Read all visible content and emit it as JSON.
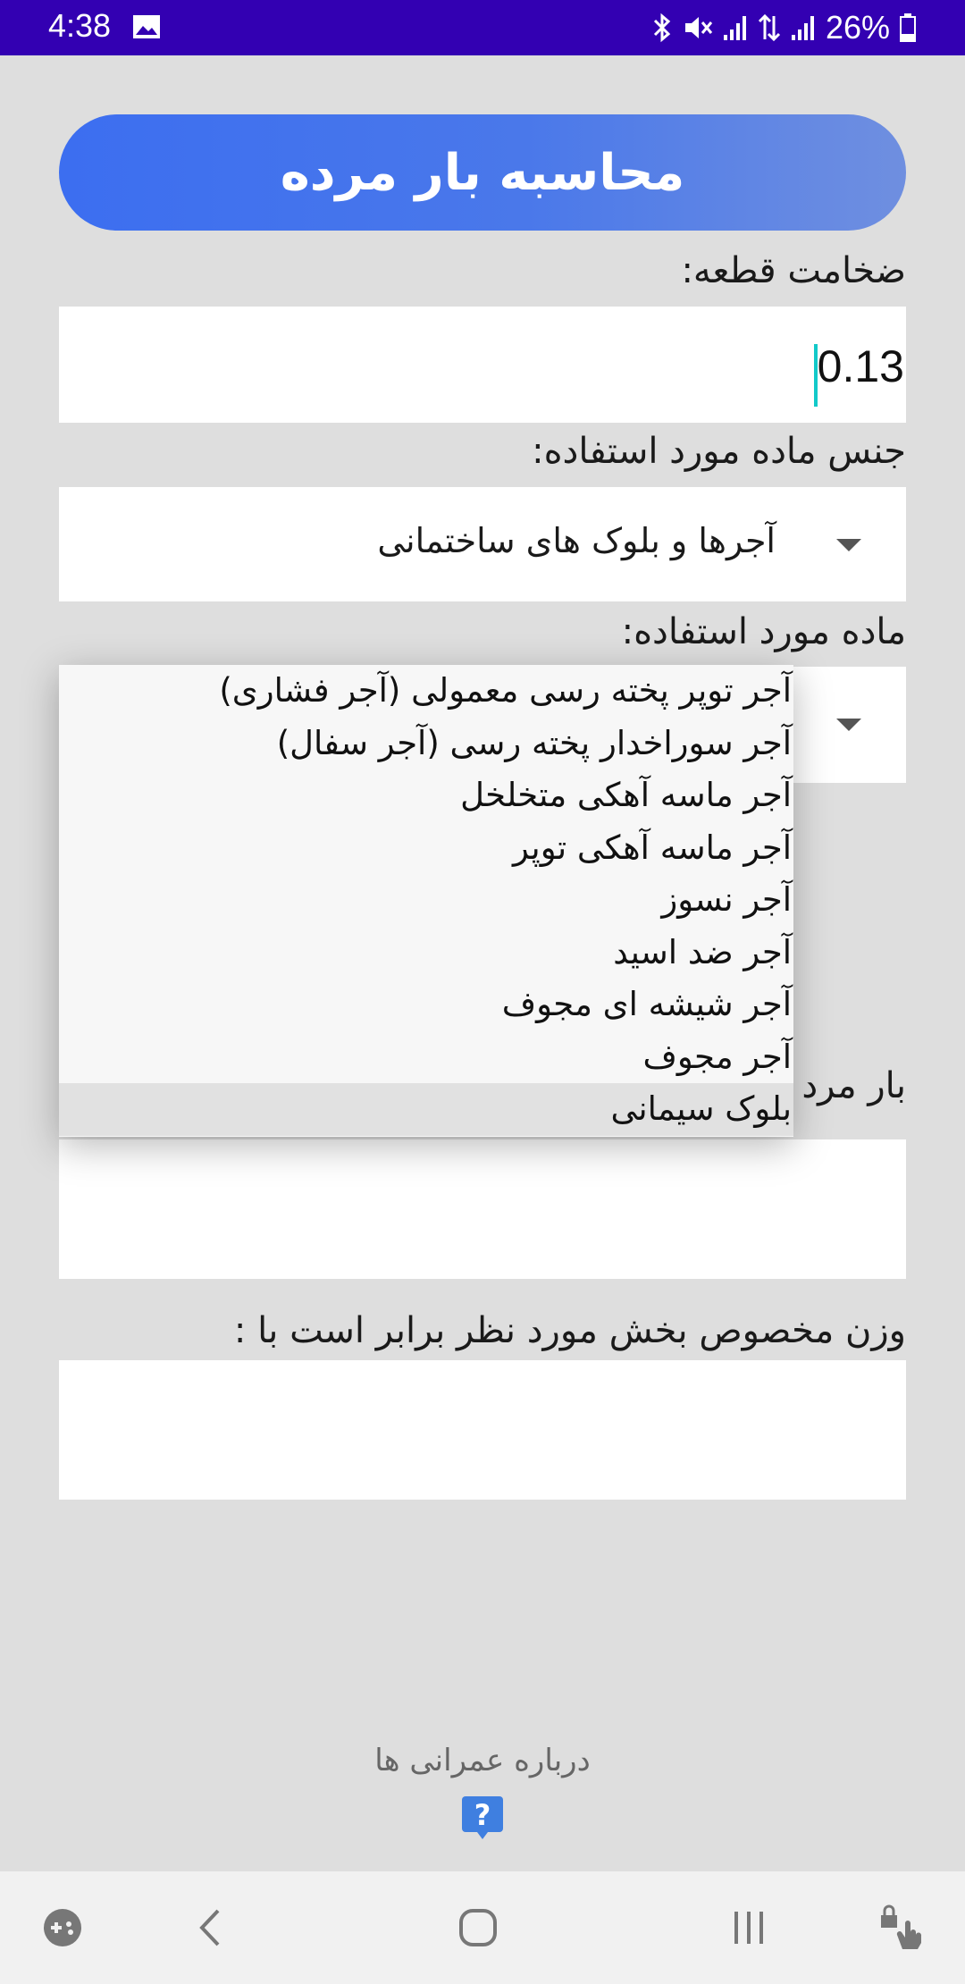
{
  "status_bar": {
    "time": "4:38",
    "battery": "26%",
    "icons": [
      "image-icon",
      "bluetooth-icon",
      "mute-icon",
      "signal-icon",
      "data-icon",
      "signal-icon",
      "battery-icon"
    ]
  },
  "header": {
    "title": "محاسبه بار مرده"
  },
  "form": {
    "thickness_label": "ضخامت قطعه:",
    "thickness_value": "0.13",
    "material_type_label": "جنس ماده مورد استفاده:",
    "material_type_value": "آجرها و بلوک های ساختمانی",
    "material_label": "ماده مورد استفاده:",
    "dead_load_label": "بار مرد",
    "density_label": "وزن مخصوص بخش مورد نظر برابر است با :"
  },
  "dropdown": {
    "options": [
      "آجر توپر پخته رسی معمولی (آجر فشاری)",
      "آجر سوراخدار پخته رسی (آجر سفال)",
      "آجر ماسه آهکی متخلخل",
      "آجر ماسه آهکی توپر",
      "آجر نسوز",
      "آجر ضد اسید",
      "آجر شیشه ای مجوف",
      "آجر مجوف",
      "بلوک سیمانی"
    ],
    "selected_index": 8
  },
  "footer": {
    "about_label": "درباره عمرانی ها",
    "help_icon": "question-icon"
  },
  "nav_bar": {
    "icons": [
      "game-launcher-icon",
      "back-icon",
      "home-icon",
      "recents-icon",
      "touch-lock-icon"
    ]
  },
  "colors": {
    "status_bar": "#3300b2",
    "header_gradient_start": "#3c6ef0",
    "header_gradient_end": "#6f8fe0",
    "background": "#dedede",
    "cursor": "#12c9c9"
  }
}
